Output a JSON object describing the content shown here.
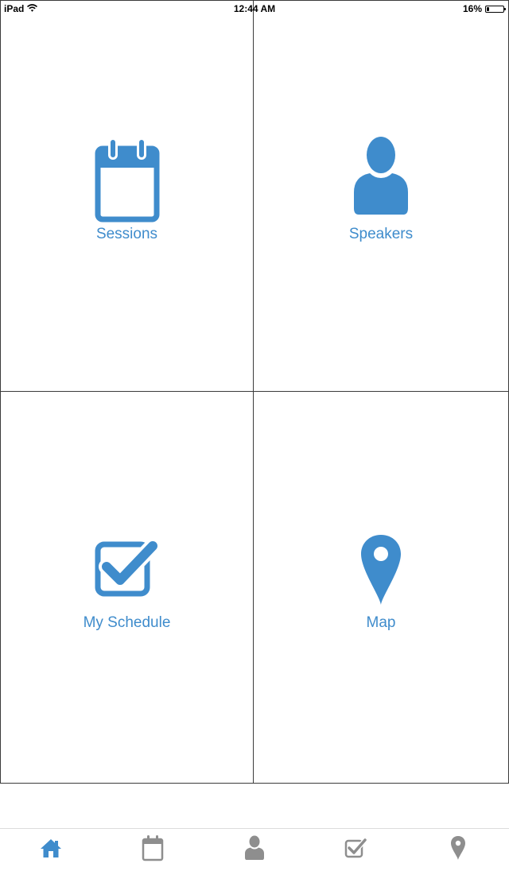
{
  "status_bar": {
    "carrier": "iPad",
    "time": "12:44 AM",
    "battery_percent": "16%",
    "battery_level": 0.16
  },
  "tiles": [
    {
      "label": "Sessions",
      "icon": "calendar-icon"
    },
    {
      "label": "Speakers",
      "icon": "person-icon"
    },
    {
      "label": "My Schedule",
      "icon": "checkbox-icon"
    },
    {
      "label": "Map",
      "icon": "map-pin-icon"
    }
  ],
  "tab_bar": {
    "items": [
      {
        "icon": "home-icon",
        "active": true
      },
      {
        "icon": "calendar-icon",
        "active": false
      },
      {
        "icon": "person-icon",
        "active": false
      },
      {
        "icon": "checkbox-icon",
        "active": false
      },
      {
        "icon": "map-pin-icon",
        "active": false
      }
    ]
  },
  "colors": {
    "accent": "#3f8ccc",
    "inactive_tab": "#8e8e8e",
    "grid_border": "#3b3b3b"
  }
}
